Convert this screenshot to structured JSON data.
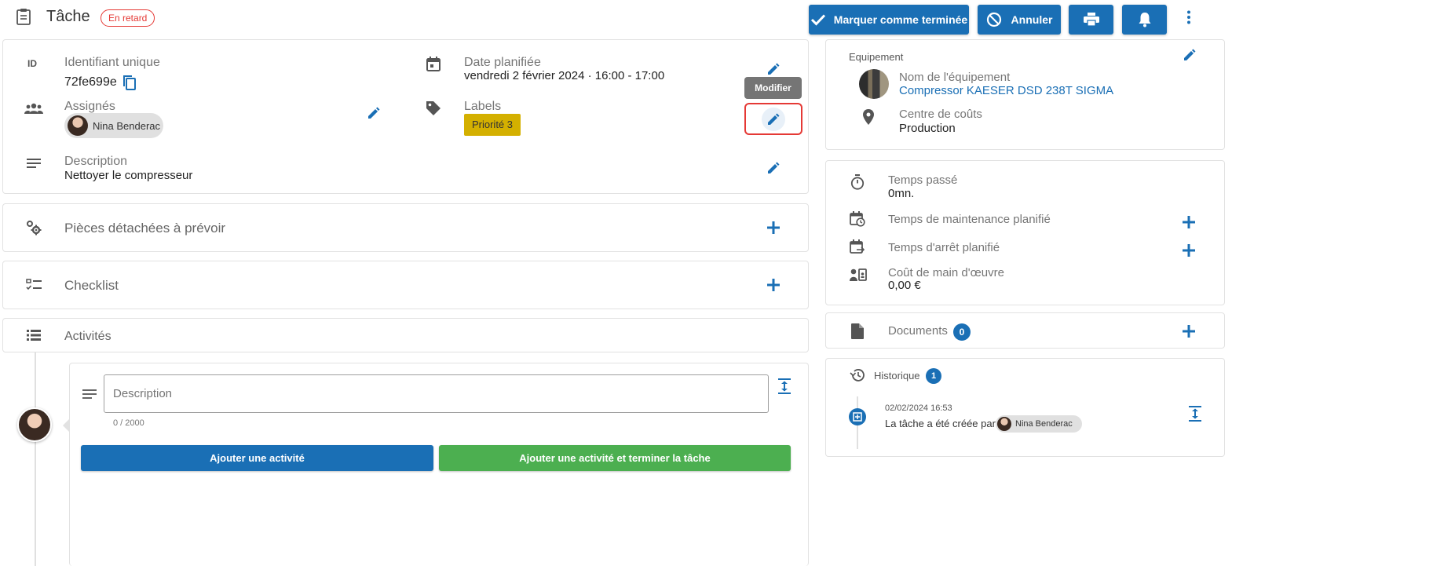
{
  "header": {
    "title": "Tâche",
    "status_badge": "En retard",
    "actions": {
      "complete": "Marquer comme terminée",
      "cancel": "Annuler"
    }
  },
  "details": {
    "id_label": "Identifiant unique",
    "id_value": "72fe699e",
    "id_icon_text": "ID",
    "assignees_label": "Assignés",
    "assignee_name": "Nina Benderac",
    "date_label": "Date planifiée",
    "date_value": "vendredi 2 février 2024 · 16:00 - 17:00",
    "labels_label": "Labels",
    "label_chip": "Priorité 3",
    "description_label": "Description",
    "description_value": "Nettoyer le compresseur",
    "tooltip": "Modifier"
  },
  "sections": {
    "parts": "Pièces détachées à prévoir",
    "checklist": "Checklist",
    "activities": "Activités"
  },
  "activity_form": {
    "placeholder": "Description",
    "counter": "0 / 2000",
    "add_button": "Ajouter une activité",
    "add_complete_button": "Ajouter une activité et terminer la tâche"
  },
  "equipment": {
    "section_label": "Equipement",
    "name_label": "Nom de l'équipement",
    "name_value": "Compressor KAESER DSD 238T SIGMA",
    "cost_center_label": "Centre de coûts",
    "cost_center_value": "Production"
  },
  "time": {
    "spent_label": "Temps passé",
    "spent_value": "0mn.",
    "maintenance_label": "Temps de maintenance planifié",
    "downtime_label": "Temps d'arrêt planifié",
    "labor_label": "Coût de main d'œuvre",
    "labor_value": "0,00 €"
  },
  "documents": {
    "label": "Documents",
    "count": "0"
  },
  "history": {
    "label": "Historique",
    "count": "1",
    "entry_time": "02/02/2024 16:53",
    "entry_text": "La tâche a été créée par",
    "entry_user": "Nina Benderac"
  },
  "colors": {
    "primary": "#1a6fb5",
    "success": "#4caf50",
    "warning_chip": "#d4b000",
    "danger": "#e53935"
  }
}
